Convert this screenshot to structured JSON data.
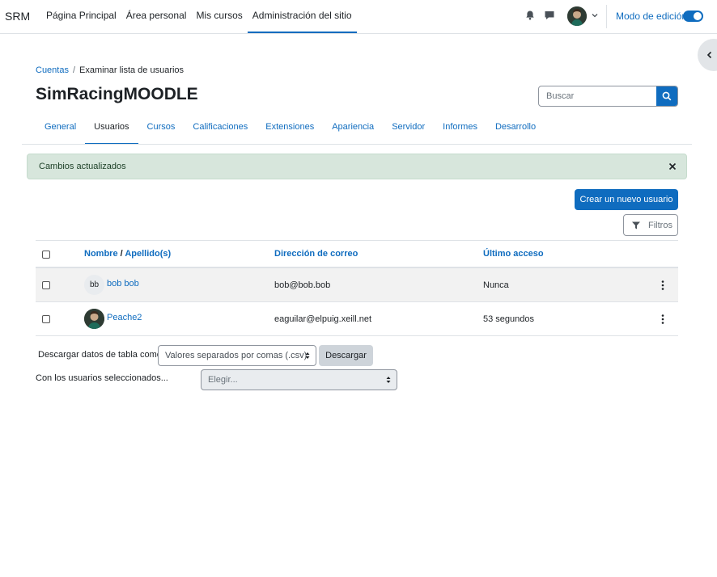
{
  "navbar": {
    "brand": "SRM",
    "links": [
      {
        "label": "Página Principal"
      },
      {
        "label": "Área personal"
      },
      {
        "label": "Mis cursos"
      },
      {
        "label": "Administración del sitio",
        "active": true
      }
    ],
    "edit_mode_label": "Modo de edición",
    "edit_mode_on": true
  },
  "breadcrumb": {
    "items": [
      "Cuentas",
      "Examinar lista de usuarios"
    ]
  },
  "page": {
    "title": "SimRacingMOODLE"
  },
  "search": {
    "placeholder": "Buscar"
  },
  "tabs": [
    {
      "label": "General"
    },
    {
      "label": "Usuarios",
      "active": true
    },
    {
      "label": "Cursos"
    },
    {
      "label": "Calificaciones"
    },
    {
      "label": "Extensiones"
    },
    {
      "label": "Apariencia"
    },
    {
      "label": "Servidor"
    },
    {
      "label": "Informes"
    },
    {
      "label": "Desarrollo"
    }
  ],
  "alert": {
    "message": "Cambios actualizados"
  },
  "actions": {
    "create_user": "Crear un nuevo usuario",
    "filters": "Filtros"
  },
  "table": {
    "headers": {
      "name": "Nombre",
      "surname": "Apellido(s)",
      "email": "Dirección de correo",
      "last_access": "Último acceso"
    },
    "rows": [
      {
        "initials": "bb",
        "name": "bob bob",
        "email": "bob@bob.bob",
        "last_access": "Nunca"
      },
      {
        "initials": "",
        "name": "Peache2",
        "email": "eaguilar@elpuig.xeill.net",
        "last_access": "53 segundos"
      }
    ]
  },
  "download": {
    "label": "Descargar datos de tabla como",
    "format": "Valores separados por comas (.csv)",
    "button": "Descargar"
  },
  "bulk": {
    "label": "Con los usuarios seleccionados...",
    "placeholder": "Elegir..."
  },
  "colors": {
    "primary": "#0f6cbf",
    "alert_bg": "#d7e6dc",
    "text": "#1d2125"
  }
}
